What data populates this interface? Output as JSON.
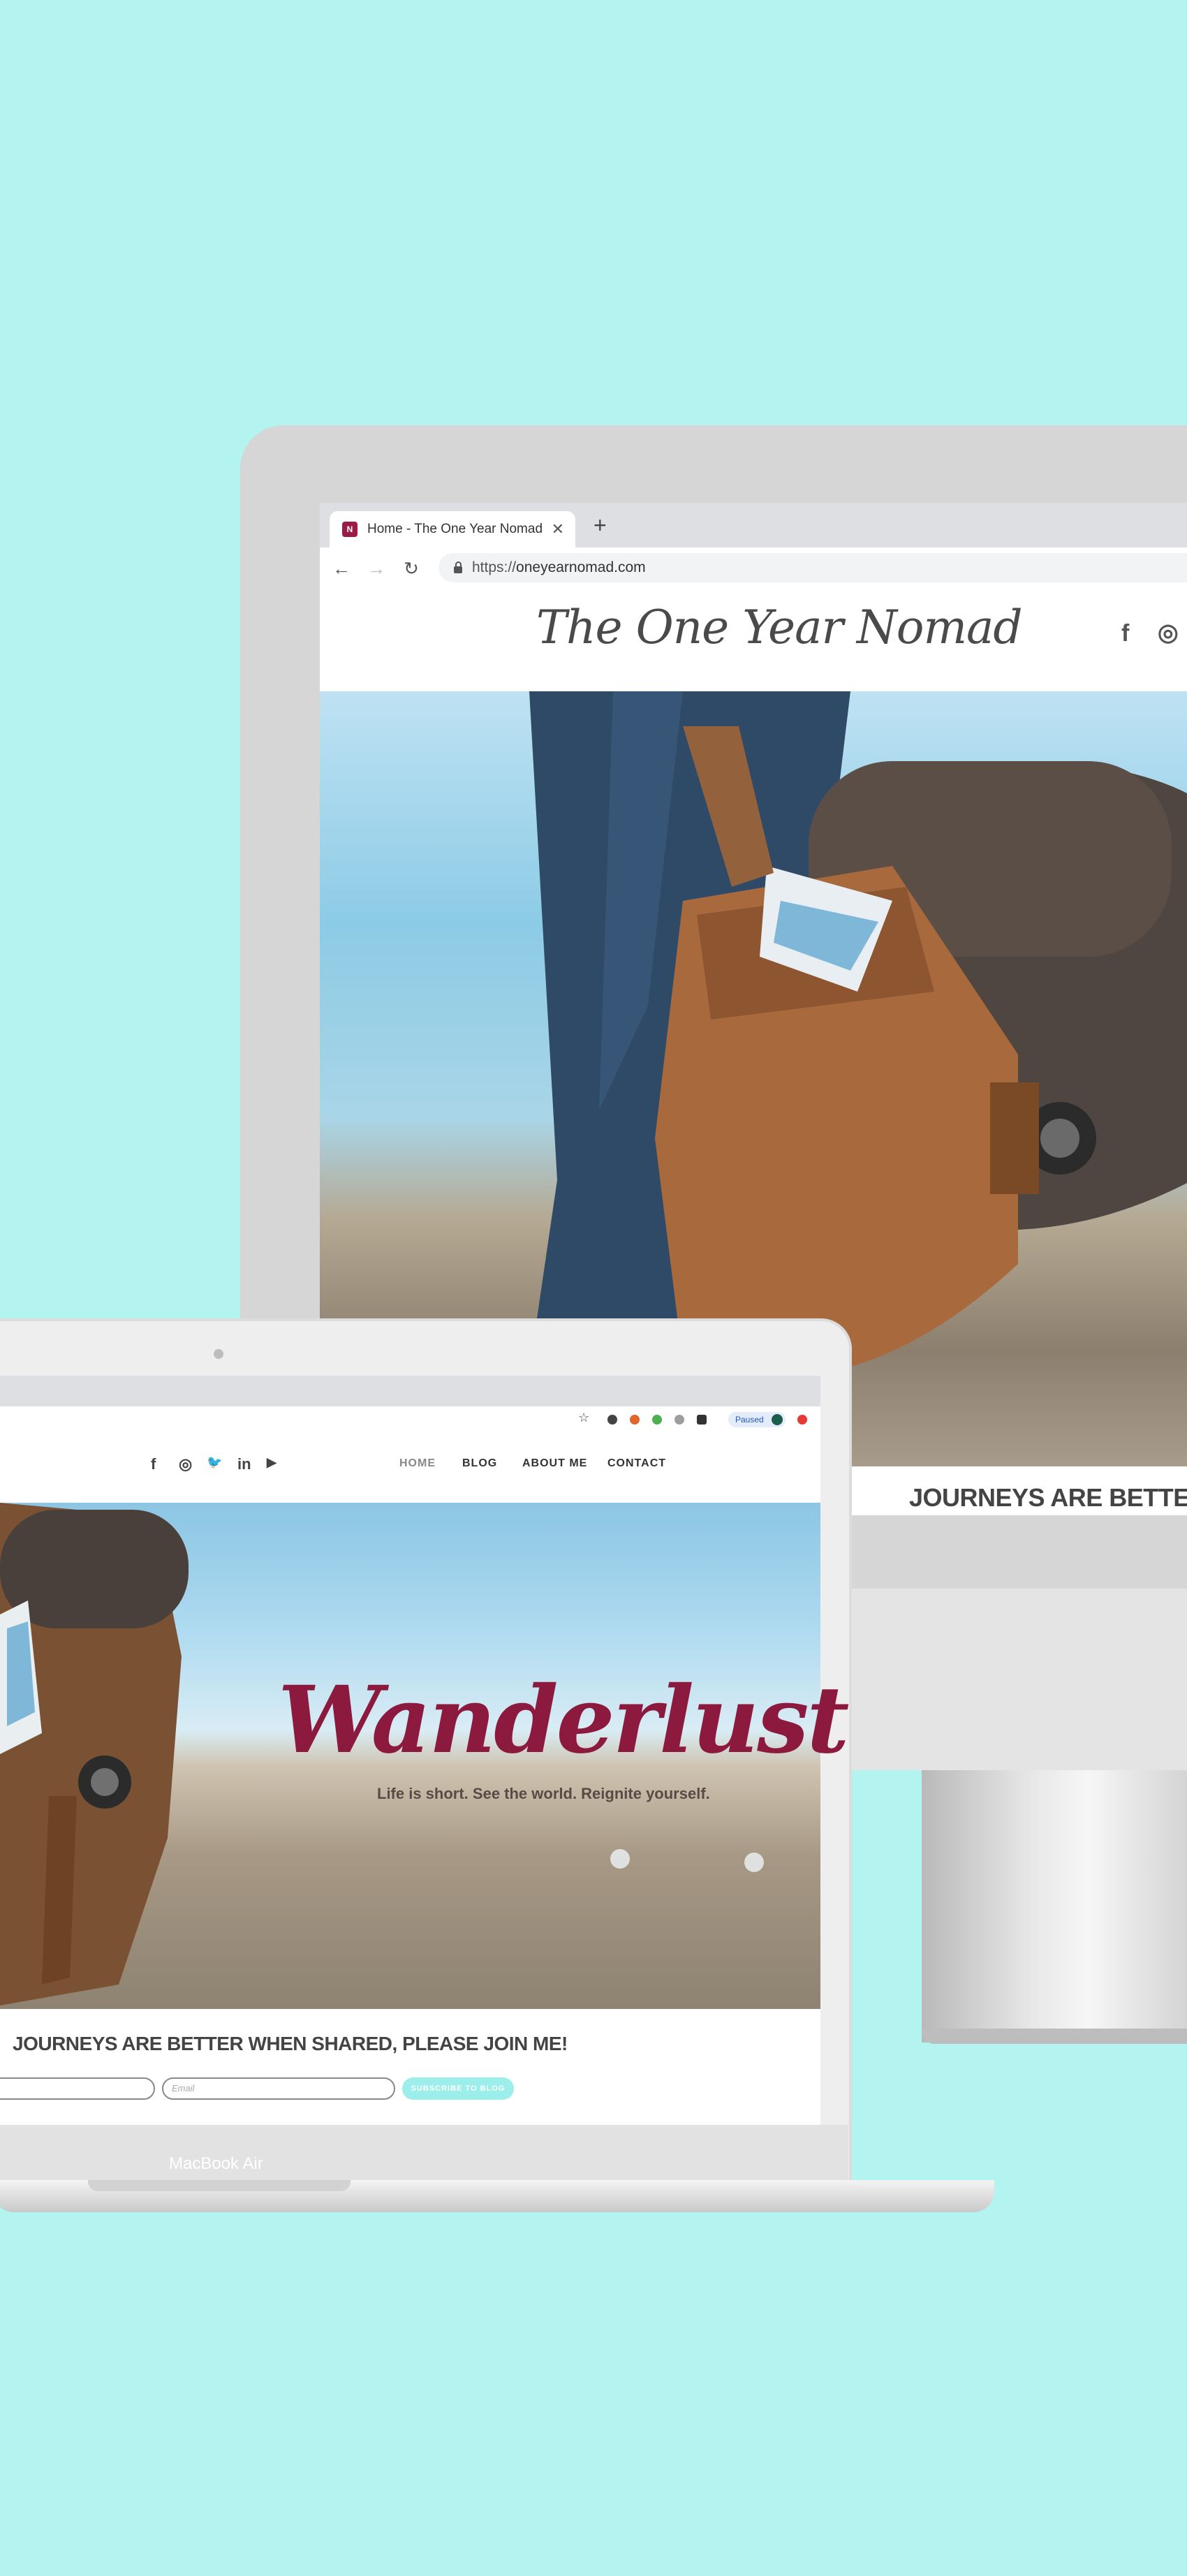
{
  "imac": {
    "tab_title": "Home - The One Year Nomad",
    "tab_close": "✕",
    "new_tab": "+",
    "url_prefix": "https://",
    "url_host": "oneyearnomad.com",
    "site_logo": "The One Year Nomad",
    "join_heading": "JOURNEYS ARE BETTER W",
    "social": {
      "facebook": "f",
      "instagram": "◎"
    }
  },
  "macbook": {
    "social": {
      "facebook": "f",
      "instagram": "◎",
      "twitter": "🐦",
      "linkedin": "in",
      "youtube": "▶"
    },
    "nav": {
      "home": "HOME",
      "blog": "BLOG",
      "about": "ABOUT ME",
      "contact": "CONTACT"
    },
    "extensions": {
      "paused_label": "Paused"
    },
    "hero_title": "Wanderlust",
    "hero_tagline": "Life is short. See the world. Reignite yourself.",
    "join_heading": "JOURNEYS ARE BETTER WHEN SHARED, PLEASE JOIN ME!",
    "email_placeholder": "Email",
    "subscribe_label": "SUBSCRIBE TO BLOG",
    "model_label": "MacBook Air"
  },
  "colors": {
    "background": "#b3f3f0",
    "brand": "#8c1a3f",
    "subscribe": "#9beee9"
  }
}
